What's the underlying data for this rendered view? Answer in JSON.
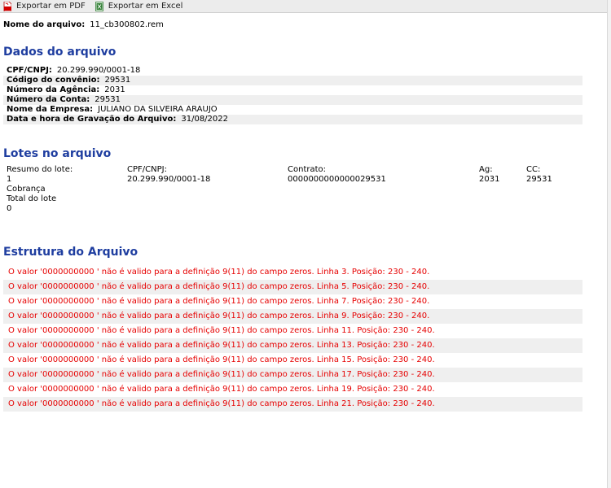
{
  "toolbar": {
    "pdf_label": "Exportar em PDF",
    "excel_label": "Exportar em Excel",
    "pdf_icon": "pdf-icon",
    "excel_icon": "excel-icon"
  },
  "file": {
    "label": "Nome do arquivo:",
    "value": "11_cb300802.rem"
  },
  "dados": {
    "heading": "Dados do arquivo",
    "rows": [
      {
        "label": "CPF/CNPJ:",
        "value": "20.299.990/0001-18"
      },
      {
        "label": "Código do convênio:",
        "value": "29531"
      },
      {
        "label": "Número da Agência:",
        "value": "2031"
      },
      {
        "label": "Número da Conta:",
        "value": "29531"
      },
      {
        "label": "Nome da Empresa:",
        "value": "JULIANO DA SILVEIRA ARAUJO"
      },
      {
        "label": "Data e hora de Gravação do Arquivo:",
        "value": "31/08/2022"
      }
    ]
  },
  "lotes": {
    "heading": "Lotes no arquivo",
    "resumo_label": "Resumo do lote:",
    "resumo_value": "1",
    "tipo": "Cobrança",
    "total_label": "Total do lote",
    "total_value": "0",
    "cpf_label": "CPF/CNPJ:",
    "cpf_value": "20.299.990/0001-18",
    "contrato_label": "Contrato:",
    "contrato_value": "0000000000000029531",
    "ag_label": "Ag:",
    "ag_value": "2031",
    "cc_label": "CC:",
    "cc_value": "29531"
  },
  "estrutura": {
    "heading": "Estrutura do Arquivo",
    "errors": [
      "O valor '0000000000 ' não é valido para a definição 9(11) do campo zeros. Linha 3. Posição: 230 - 240.",
      "O valor '0000000000 ' não é valido para a definição 9(11) do campo zeros. Linha 5. Posição: 230 - 240.",
      "O valor '0000000000 ' não é valido para a definição 9(11) do campo zeros. Linha 7. Posição: 230 - 240.",
      "O valor '0000000000 ' não é valido para a definição 9(11) do campo zeros. Linha 9. Posição: 230 - 240.",
      "O valor '0000000000 ' não é valido para a definição 9(11) do campo zeros. Linha 11. Posição: 230 - 240.",
      "O valor '0000000000 ' não é valido para a definição 9(11) do campo zeros. Linha 13. Posição: 230 - 240.",
      "O valor '0000000000 ' não é valido para a definição 9(11) do campo zeros. Linha 15. Posição: 230 - 240.",
      "O valor '0000000000 ' não é valido para a definição 9(11) do campo zeros. Linha 17. Posição: 230 - 240.",
      "O valor '0000000000 ' não é valido para a definição 9(11) do campo zeros. Linha 19. Posição: 230 - 240.",
      "O valor '0000000000 ' não é valido para a definição 9(11) do campo zeros. Linha 21. Posição: 230 - 240."
    ]
  }
}
